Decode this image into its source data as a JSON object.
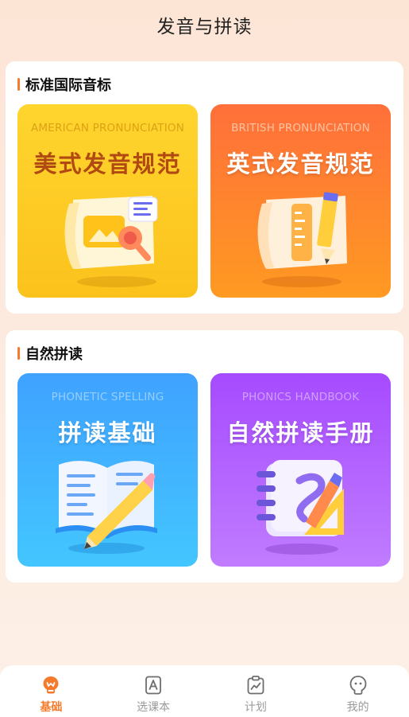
{
  "header": {
    "title": "发音与拼读"
  },
  "sections": [
    {
      "title": "标准国际音标",
      "cards": [
        {
          "subtitle": "AMERICAN PRONUNCIATION",
          "title": "美式发音规范"
        },
        {
          "subtitle": "BRITISH PRONUNCIATION",
          "title": "英式发音规范"
        }
      ]
    },
    {
      "title": "自然拼读",
      "cards": [
        {
          "subtitle": "PHONETIC SPELLING",
          "title": "拼读基础"
        },
        {
          "subtitle": "PHONICS HANDBOOK",
          "title": "自然拼读手册"
        }
      ]
    }
  ],
  "tabbar": {
    "tabs": [
      {
        "label": "基础",
        "icon": "home-bulb-icon",
        "active": true
      },
      {
        "label": "选课本",
        "icon": "textbook-icon",
        "active": false
      },
      {
        "label": "计划",
        "icon": "plan-clipboard-icon",
        "active": false
      },
      {
        "label": "我的",
        "icon": "profile-icon",
        "active": false
      }
    ]
  },
  "colors": {
    "accent": "#f57a2c",
    "card_yellow": "#ffd52e",
    "card_orange": "#ff7f2e",
    "card_blue": "#3fb2ff",
    "card_purple": "#b15eff"
  }
}
